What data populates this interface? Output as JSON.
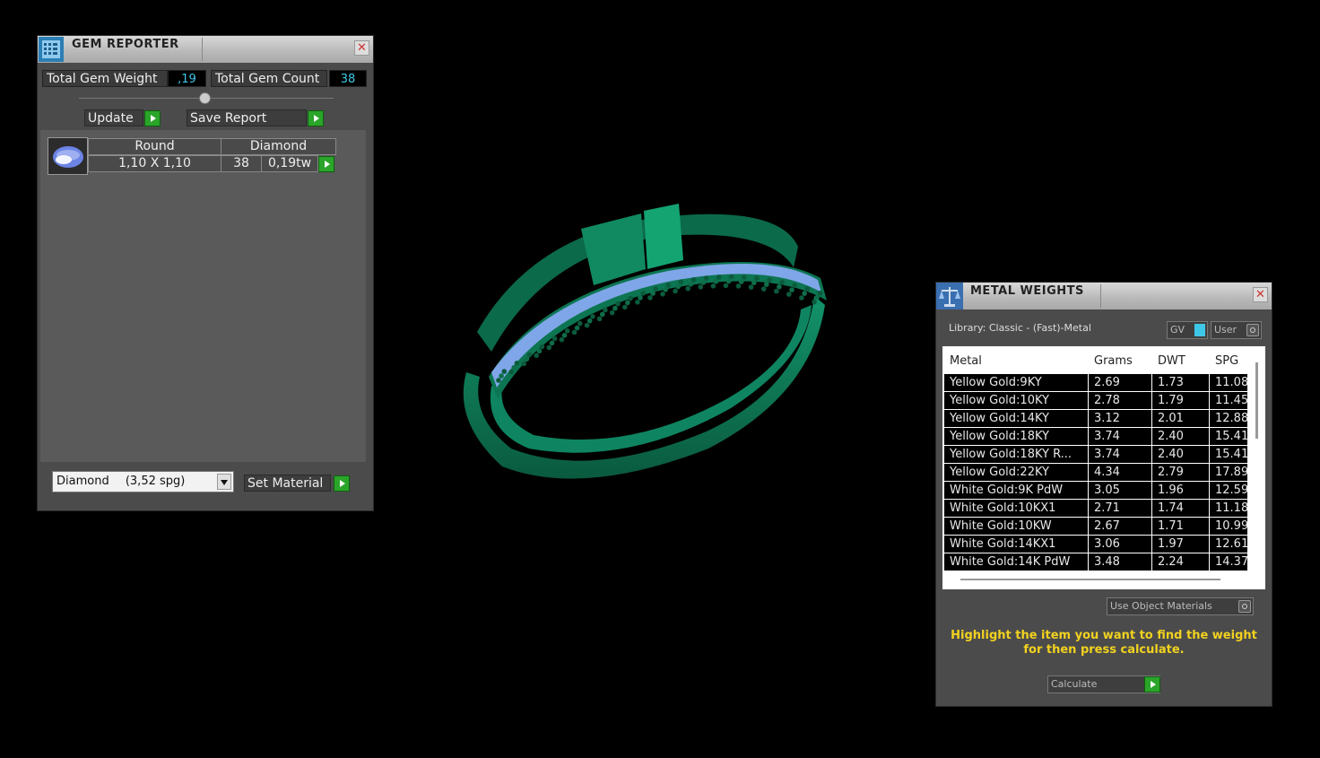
{
  "gem_reporter": {
    "title": "GEM REPORTER",
    "total_gem_weight_label": "Total Gem Weight",
    "total_gem_weight": ",19",
    "total_gem_count_label": "Total Gem Count",
    "total_gem_count": "38",
    "update_label": "Update",
    "save_report_label": "Save Report",
    "gem": {
      "shape": "Round",
      "stone": "Diamond",
      "size": "1,10 X 1,10",
      "count": "38",
      "weight": "0,19tw"
    },
    "material_select": "Diamond",
    "material_spg": "(3,52 spg)",
    "set_material_label": "Set Material"
  },
  "metal_weights": {
    "title": "METAL WEIGHTS",
    "library": "Library: Classic - (Fast)-Metal",
    "gv_label": "GV",
    "user_label": "User",
    "columns": [
      "Metal",
      "Grams",
      "DWT",
      "SPG"
    ],
    "rows": [
      [
        "Yellow Gold:9KY",
        "2.69",
        "1.73",
        "11.08"
      ],
      [
        "Yellow Gold:10KY",
        "2.78",
        "1.79",
        "11.45"
      ],
      [
        "Yellow Gold:14KY",
        "3.12",
        "2.01",
        "12.88"
      ],
      [
        "Yellow Gold:18KY",
        "3.74",
        "2.40",
        "15.41"
      ],
      [
        "Yellow Gold:18KY R...",
        "3.74",
        "2.40",
        "15.41"
      ],
      [
        "Yellow Gold:22KY",
        "4.34",
        "2.79",
        "17.89"
      ],
      [
        "White Gold:9K PdW",
        "3.05",
        "1.96",
        "12.59"
      ],
      [
        "White Gold:10KX1",
        "2.71",
        "1.74",
        "11.18"
      ],
      [
        "White Gold:10KW",
        "2.67",
        "1.71",
        "10.99"
      ],
      [
        "White Gold:14KX1",
        "3.06",
        "1.97",
        "12.61"
      ],
      [
        "White Gold:14K PdW",
        "3.48",
        "2.24",
        "14.37"
      ]
    ],
    "use_object_materials_label": "Use Object Materials",
    "hint_line1": "Highlight the item you want to find the weight",
    "hint_line2": "for then press calculate.",
    "calculate_label": "Calculate"
  },
  "colors": {
    "ring_green": "#0f7a55",
    "gem_blue": "#7fa6e8",
    "hint_yellow": "#f2d21f",
    "value_cyan": "#3fc7e8",
    "go_green": "#2aa52a"
  }
}
